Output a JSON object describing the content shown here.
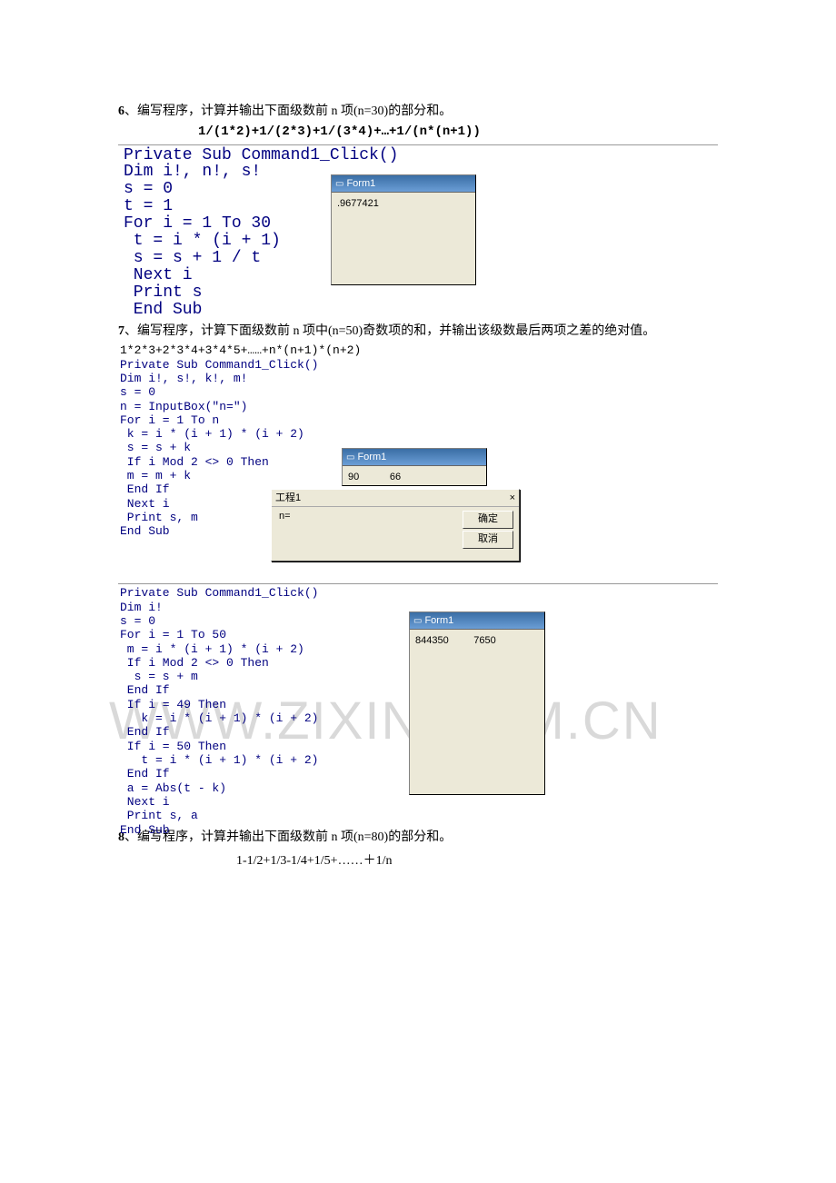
{
  "p6": {
    "title_prefix": "6",
    "title_text": "、编写程序，计算并输出下面级数前 n 项(n=30)的部分和。",
    "formula": "1/(1*2)+1/(2*3)+1/(3*4)+…+1/(n*(n+1))",
    "code": "Private Sub Command1_Click()\nDim i!, n!, s!\ns = 0\nt = 1\nFor i = 1 To 30\n t = i * (i + 1)\n s = s + 1 / t\n Next i\n Print s\n End Sub",
    "win_title": "Form1",
    "win_output": ".9677421"
  },
  "p7": {
    "title_prefix": "7",
    "title_text": "、编写程序，计算下面级数前 n 项中(n=50)奇数项的和，并输出该级数最后两项之差的绝对值。",
    "series": "1*2*3+2*3*4+3*4*5+……+n*(n+1)*(n+2)",
    "codeA": "Private Sub Command1_Click()\nDim i!, s!, k!, m!\ns = 0\nn = InputBox(\"n=\")\nFor i = 1 To n\n k = i * (i + 1) * (i + 2)\n s = s + k\n If i Mod 2 <> 0 Then\n m = m + k\n End If\n Next i\n Print s, m\nEnd Sub",
    "winA_title": "Form1",
    "winA_out1": "90",
    "winA_out2": "66",
    "ib_title": "工程1",
    "ib_close": "×",
    "ib_label": "n=",
    "ib_ok": "确定",
    "ib_cancel": "取消",
    "codeB": "Private Sub Command1_Click()\nDim i!\ns = 0\nFor i = 1 To 50\n m = i * (i + 1) * (i + 2)\n If i Mod 2 <> 0 Then\n  s = s + m\n End If\n If i = 49 Then\n   k = i * (i + 1) * (i + 2)\n End If\n If i = 50 Then\n   t = i * (i + 1) * (i + 2)\n End If\n a = Abs(t - k)\n Next i\n Print s, a\nEnd Sub",
    "winB_title": "Form1",
    "winB_out1": "844350",
    "winB_out2": "7650"
  },
  "p8": {
    "title_prefix": "8",
    "title_text": "、编写程序，计算并输出下面级数前 n 项(n=80)的部分和。",
    "formula": "1-1/2+1/3-1/4+1/5+……＋1/n"
  },
  "watermark": "WWW.ZIXIN.COM.CN",
  "icon_label": "form-icon"
}
